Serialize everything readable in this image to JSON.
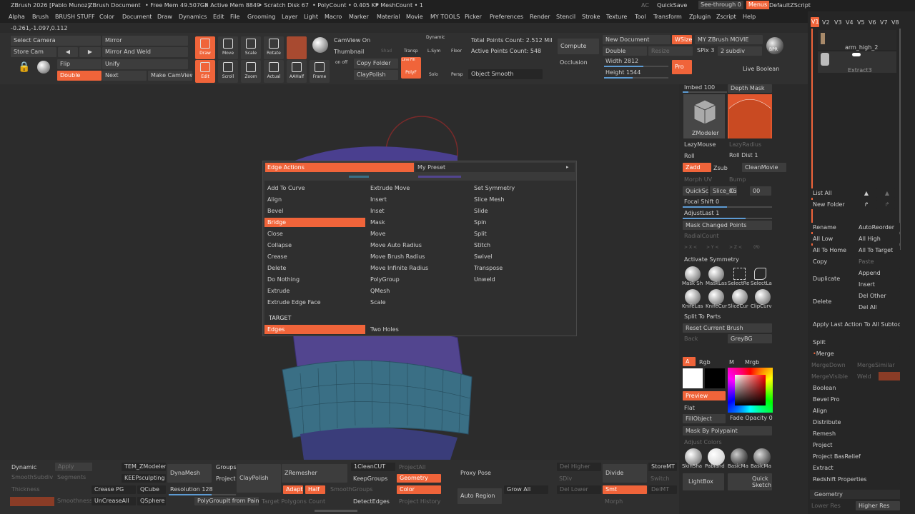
{
  "title_bar": {
    "app": "ZBrush 2026 [Pablo Munoz]",
    "document": "ZBrush Document",
    "free_mem": "• Free Mem 49.507GB",
    "active_mem": "• Active Mem 8849",
    "scratch": "• Scratch Disk 67",
    "polycount": "• PolyCount • 0.405 KP",
    "meshcount": "• MeshCount • 1",
    "ac": "AC",
    "quicksave": "QuickSave",
    "seethrough": "See-through",
    "seethrough_value": "0",
    "menus": "Menus",
    "default_script": "DefaultZScript"
  },
  "menu": [
    "Alpha",
    "Brush",
    "BRUSH STUFF",
    "Color",
    "Document",
    "Draw",
    "Dynamics",
    "Edit",
    "File",
    "Grooming",
    "Layer",
    "Light",
    "Macro",
    "Marker",
    "Material",
    "Movie",
    "MY TOOLS",
    "Picker",
    "Preferences",
    "Render",
    "Stencil",
    "Stroke",
    "Texture",
    "Tool",
    "Transform",
    "Zplugin",
    "Zscript",
    "Help"
  ],
  "coords": "-0.261,-1.097,0.112",
  "shelf": {
    "select_camera": "Select Camera",
    "mirror": "Mirror",
    "store_cam": "Store Cam",
    "mirror_weld": "Mirror And Weld",
    "flip": "Flip",
    "unify": "Unify",
    "double": "Double",
    "next": "Next",
    "make_camview": "Make CamView",
    "draw": "Draw",
    "move": "Move",
    "scale": "Scale",
    "rotate": "Rotate",
    "edit": "Edit",
    "scroll": "Scroll",
    "zoom": "Zoom",
    "actual": "Actual",
    "aahalf": "AAHalf",
    "frame": "Frame",
    "camview_on": "CamView On",
    "thumbnail": "Thumbnail",
    "copy_folder": "Copy Folder",
    "claypolish": "ClayPolish",
    "on_off": "on off",
    "shad": "Shad",
    "transp": "Transp",
    "dynamic": "Dynamic",
    "sym": "L.Sym",
    "floor": "Floor",
    "line_fill": "Line Fill",
    "polyf": "PolyF",
    "solo": "Solo",
    "persp": "Persp",
    "total_points": "Total Points Count: 2.512 Mil",
    "active_points": "Active Points Count: 548",
    "object_smooth": "Object Smooth",
    "compute": "Compute",
    "occlusion": "Occlusion",
    "new_document": "New Document",
    "wsize": "WSize",
    "double2": "Double",
    "resize": "Resize",
    "width_label": "Width 2812",
    "height_label": "Height 1544",
    "pro": "Pro",
    "movie": "MY ZBrush MOVIE",
    "spix": "SPix 3",
    "subdiv": "2 subdiv",
    "bpr": "BPR",
    "live_boolean": "Live Boolean"
  },
  "popup": {
    "header_left": "Edge Actions",
    "header_right": "My Preset",
    "col1": [
      "Add To Curve",
      "Align",
      "Bevel",
      "Bridge",
      "Close",
      "Collapse",
      "Crease",
      "Delete",
      "Do Nothing",
      "Extrude",
      "Extrude Edge Face"
    ],
    "col2": [
      "Extrude Move",
      "Insert",
      "Inset",
      "Mask",
      "Move",
      "Move Auto Radius",
      "Move Brush Radius",
      "Move Infinite Radius",
      "PolyGroup",
      "QMesh",
      "Scale"
    ],
    "col3": [
      "Set Symmetry",
      "Slice Mesh",
      "Slide",
      "Spin",
      "Split",
      "Stitch",
      "Swivel",
      "Transpose",
      "Unweld"
    ],
    "selected": "Bridge",
    "target_label": "TARGET",
    "target_selected": "Edges",
    "target_other": "Two Holes"
  },
  "right": {
    "imbed": "Imbed 100",
    "depth_mask": "Depth Mask",
    "zmodeler": "ZModeler",
    "lazymouse": "LazyMouse",
    "lazyradius": "LazyRadius",
    "roll": "Roll",
    "roll_dist": "Roll Dist 1",
    "zadd": "Zadd",
    "zsub": "Zsub",
    "cleanmovie": "CleanMovie",
    "morph_uv": "Morph UV",
    "bump": "Bump",
    "quicksc": "QuickSc",
    "slice_c": "Slice_Cu",
    "x5": "X5",
    "zero": "00",
    "focal": "Focal Shift 0",
    "adjustlast": "AdjustLast 1",
    "mask_changed": "Mask Changed Points",
    "radialcount": "RadialCount",
    "xyz": [
      "> X <",
      "> Y <",
      "> Z <",
      "(R)"
    ],
    "activate_sym": "Activate Symmetry",
    "brushes1": [
      "Mask Sh",
      "MaskLas",
      "SelectRe",
      "SelectLa"
    ],
    "brushes2": [
      "KnifeLas",
      "KnifeCur",
      "SliceCur",
      "ClipCurv"
    ],
    "split_parts": "Split To Parts",
    "reset_brush": "Reset Current Brush",
    "back": "Back",
    "greybg": "GreyBG",
    "a": "A",
    "rgb": "Rgb",
    "m": "M",
    "mrgb": "Mrgb",
    "preview": "Preview",
    "flat": "Flat",
    "fillobject": "FillObject",
    "fade_opacity": "Fade Opacity 0",
    "mask_polypaint": "Mask By Polypaint",
    "adjust_colors": "Adjust Colors",
    "materials": [
      "SkinSha",
      "Pabland",
      "BasicMa",
      "BasicMa"
    ],
    "lightbox": "LightBox",
    "quick_sketch": "Quick Sketch"
  },
  "subtool": {
    "versions": [
      "V1",
      "V2",
      "V3",
      "V4",
      "V5",
      "V6",
      "V7",
      "V8"
    ],
    "item1": "arm_high_2",
    "item2": "Extract3",
    "list_all": "List All",
    "new_folder": "New Folder",
    "rename": "Rename",
    "autoreorder": "AutoReorder",
    "all_low": "All Low",
    "all_high": "All High",
    "all_to_home": "All To Home",
    "all_to_target": "All To Target",
    "copy": "Copy",
    "paste": "Paste",
    "duplicate": "Duplicate",
    "append": "Append",
    "insert": "Insert",
    "delete": "Delete",
    "del_other": "Del Other",
    "del_all": "Del All",
    "apply_last": "Apply Last Action To All Subtools",
    "split": "Split",
    "merge": "Merge",
    "mergedown": "MergeDown",
    "mergesimilar": "MergeSimilar",
    "mergevisible": "MergeVisible",
    "weld": "Weld",
    "boolean": "Boolean",
    "bevel_pro": "Bevel Pro",
    "align": "Align",
    "distribute": "Distribute",
    "remesh": "Remesh",
    "project": "Project",
    "project_bas": "Project BasRelief",
    "extract": "Extract",
    "redshift": "Redshift Properties",
    "geometry": "Geometry",
    "lower_res": "Lower Res",
    "higher_res": "Higher Res"
  },
  "bottom": {
    "dynamic": "Dynamic",
    "apply": "Apply",
    "smoothsubdiv": "SmoothSubdiv",
    "segments": "Segments",
    "thickness": "Thickness",
    "smoothness": "Smoothness",
    "tem_zmodeler": "TEM_ZModeler",
    "keepsculpting": "KEEPsculpting",
    "crease_pg": "Crease PG",
    "qcube": "QCube",
    "uncreaseall": "UnCreaseAll",
    "qsphere": "QSphere",
    "dynamesh": "DynaMesh",
    "groups": "Groups",
    "project": "Project",
    "claypolish": "ClayPolish",
    "resolution": "Resolution 128",
    "polygroupit": "PolyGroupIt from Paint",
    "target_poly": "Target Polygons Count",
    "zremesher": "ZRemesher",
    "adapt": "Adapt",
    "half": "Half",
    "smoothgroups": "SmoothGroups",
    "clean_cut": "1CleanCUT",
    "keepgroups": "KeepGroups",
    "detectedges": "DetectEdges",
    "projectall": "ProjectAll",
    "geometry": "Geometry",
    "color": "Color",
    "project_history": "Project History",
    "proxy_pose": "Proxy Pose",
    "auto_region": "Auto Region",
    "grow_all": "Grow All",
    "del_higher": "Del Higher",
    "sdiv": "SDiv",
    "del_lower": "Del Lower",
    "divide": "Divide",
    "smt": "Smt",
    "storemt": "StoreMT",
    "switch": "Switch",
    "delmt": "DelMT",
    "morph": "Morph"
  },
  "colors": {
    "accent": "#f0643a",
    "panel": "#2b2b2b",
    "mesh": "#3a6f85",
    "mesh_purple": "#4a3f8f"
  }
}
